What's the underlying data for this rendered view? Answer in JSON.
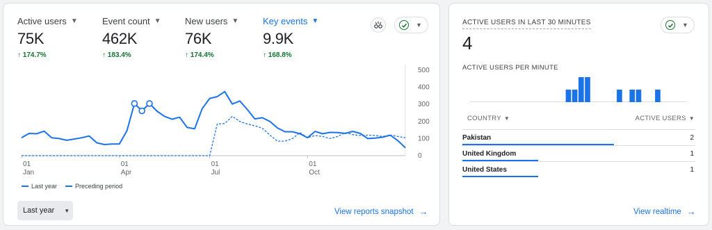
{
  "main": {
    "metrics": [
      {
        "label": "Active users",
        "value": "75K",
        "change": "174.7%",
        "active": false
      },
      {
        "label": "Event count",
        "value": "462K",
        "change": "183.4%",
        "active": false
      },
      {
        "label": "New users",
        "value": "76K",
        "change": "174.4%",
        "active": false
      },
      {
        "label": "Key events",
        "value": "9.9K",
        "change": "168.8%",
        "active": true
      }
    ],
    "legend": {
      "current": "Last year",
      "previous": "Preceding period"
    },
    "date_range": "Last year",
    "view_link": "View reports snapshot"
  },
  "chart_data": {
    "type": "line",
    "xlabel": "",
    "ylabel": "",
    "ylim": [
      0,
      500
    ],
    "yticks": [
      "500",
      "400",
      "300",
      "200",
      "100",
      "0"
    ],
    "xticks": [
      {
        "day": "01",
        "month": "Jan",
        "index": 0
      },
      {
        "day": "01",
        "month": "Apr",
        "index": 13
      },
      {
        "day": "01",
        "month": "Jul",
        "index": 25
      },
      {
        "day": "01",
        "month": "Oct",
        "index": 38
      }
    ],
    "series": [
      {
        "name": "Last year",
        "style": "solid",
        "color": "#1a73e8",
        "values": [
          105,
          130,
          128,
          143,
          105,
          100,
          90,
          97,
          105,
          115,
          75,
          65,
          68,
          68,
          145,
          305,
          262,
          305,
          260,
          230,
          213,
          225,
          165,
          157,
          275,
          335,
          345,
          375,
          302,
          320,
          270,
          215,
          222,
          200,
          162,
          140,
          140,
          128,
          105,
          142,
          128,
          136,
          135,
          130,
          142,
          130,
          100,
          103,
          108,
          120,
          88,
          46
        ]
      },
      {
        "name": "Preceding period",
        "style": "dashed",
        "color": "#1a73e8",
        "values": [
          0,
          0,
          0,
          0,
          0,
          0,
          0,
          0,
          0,
          0,
          0,
          0,
          0,
          0,
          0,
          0,
          0,
          0,
          0,
          0,
          0,
          0,
          0,
          0,
          0,
          0,
          185,
          188,
          230,
          200,
          185,
          175,
          160,
          120,
          85,
          85,
          100,
          135,
          105,
          118,
          112,
          100,
          112,
          135,
          123,
          118,
          120,
          118,
          112,
          120,
          112,
          105
        ]
      }
    ],
    "markers": [
      15,
      16,
      17
    ]
  },
  "realtime": {
    "title": "ACTIVE USERS IN LAST 30 MINUTES",
    "count": "4",
    "per_minute_label": "ACTIVE USERS PER MINUTE",
    "per_minute": [
      0,
      0,
      0,
      0,
      0,
      0,
      0,
      0,
      0,
      0,
      0,
      0,
      0,
      0,
      0,
      1,
      1,
      2,
      2,
      0,
      0,
      0,
      0,
      1,
      0,
      1,
      1,
      0,
      0,
      1,
      0,
      0,
      0,
      0
    ],
    "table": {
      "col1": "COUNTRY",
      "col2": "ACTIVE USERS",
      "rows": [
        {
          "country": "Pakistan",
          "users": "2",
          "share": 0.5
        },
        {
          "country": "United Kingdom",
          "users": "1",
          "share": 0.25
        },
        {
          "country": "United States",
          "users": "1",
          "share": 0.25
        }
      ]
    },
    "view_link": "View realtime"
  },
  "icons": {
    "caret": "▼",
    "up_arrow": "🠑",
    "arrow_right": "→",
    "check": "✓"
  }
}
